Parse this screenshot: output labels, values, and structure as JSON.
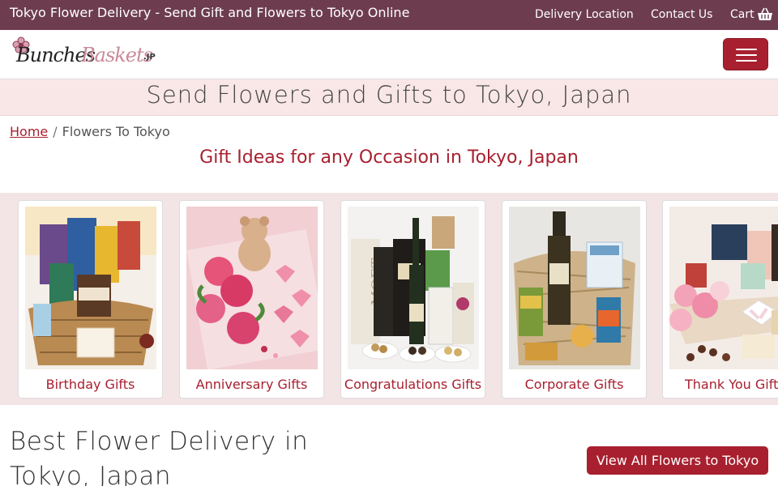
{
  "topbar": {
    "site_title": "Tokyo Flower Delivery - Send Gift and Flowers to Tokyo Online",
    "nav": {
      "delivery_location": "Delivery Location",
      "contact_us": "Contact Us",
      "cart": "Cart",
      "cart_icon": "basket-icon"
    }
  },
  "header": {
    "logo": {
      "word1": "Bunches",
      "word2": "Baskets",
      "tld": ".JP",
      "icon": "flower-icon"
    },
    "menu_icon": "hamburger-icon"
  },
  "banner": {
    "title": "Send Flowers and Gifts to Tokyo, Japan"
  },
  "breadcrumb": {
    "home": "Home",
    "separator": "/",
    "current": "Flowers To Tokyo"
  },
  "occasions": {
    "heading": "Gift Ideas for any Occasion in Tokyo, Japan",
    "cards": [
      {
        "label": "Birthday Gifts"
      },
      {
        "label": "Anniversary Gifts"
      },
      {
        "label": "Congratulations Gifts"
      },
      {
        "label": "Corporate Gifts"
      },
      {
        "label": "Thank You Gift"
      }
    ]
  },
  "best": {
    "heading": "Best Flower Delivery in Tokyo, Japan",
    "view_all_button": "View All Flowers to Tokyo"
  },
  "colors": {
    "topbar_bg": "#6d3d4f",
    "accent": "#a8202f",
    "banner_bg": "#f9e7e7",
    "carousel_bg": "#f3e4e6"
  }
}
